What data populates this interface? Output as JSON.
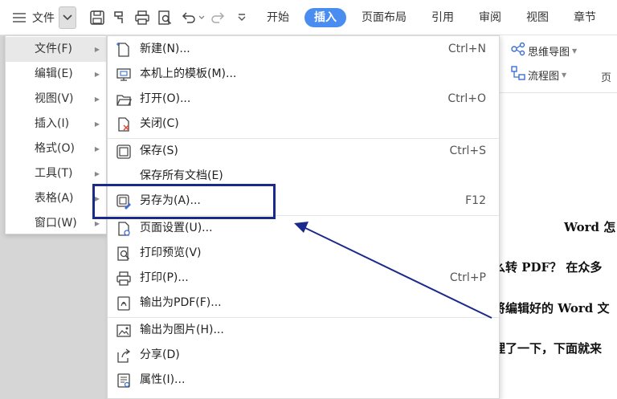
{
  "toolbar": {
    "file_label": "文件"
  },
  "tabs": [
    {
      "label": "开始"
    },
    {
      "label": "插入"
    },
    {
      "label": "页面布局"
    },
    {
      "label": "引用"
    },
    {
      "label": "审阅"
    },
    {
      "label": "视图"
    },
    {
      "label": "章节"
    }
  ],
  "active_tab": "插入",
  "ribbon": {
    "mindmap": "思维导图",
    "flowchart": "流程图",
    "partial_page": "页"
  },
  "main_menu": [
    {
      "label": "文件(F)"
    },
    {
      "label": "编辑(E)"
    },
    {
      "label": "视图(V)"
    },
    {
      "label": "插入(I)"
    },
    {
      "label": "格式(O)"
    },
    {
      "label": "工具(T)"
    },
    {
      "label": "表格(A)"
    },
    {
      "label": "窗口(W)"
    }
  ],
  "sub_menu": [
    {
      "label": "新建(N)...",
      "shortcut": "Ctrl+N",
      "icon": "new-file-icon"
    },
    {
      "label": "本机上的模板(M)...",
      "shortcut": "",
      "icon": "template-icon"
    },
    {
      "label": "打开(O)...",
      "shortcut": "Ctrl+O",
      "icon": "folder-open-icon"
    },
    {
      "label": "关闭(C)",
      "shortcut": "",
      "icon": "close-file-icon"
    },
    {
      "label": "保存(S)",
      "shortcut": "Ctrl+S",
      "icon": "save-icon"
    },
    {
      "label": "保存所有文档(E)",
      "shortcut": "",
      "icon": ""
    },
    {
      "label": "另存为(A)...",
      "shortcut": "F12",
      "icon": "save-as-icon"
    },
    {
      "label": "页面设置(U)...",
      "shortcut": "",
      "icon": "page-setup-icon"
    },
    {
      "label": "打印预览(V)",
      "shortcut": "",
      "icon": "print-preview-icon"
    },
    {
      "label": "打印(P)...",
      "shortcut": "Ctrl+P",
      "icon": "print-icon"
    },
    {
      "label": "输出为PDF(F)...",
      "shortcut": "",
      "icon": "export-pdf-icon"
    },
    {
      "label": "输出为图片(H)...",
      "shortcut": "",
      "icon": "export-image-icon"
    },
    {
      "label": "分享(D)",
      "shortcut": "",
      "icon": "share-icon"
    },
    {
      "label": "属性(I)...",
      "shortcut": "",
      "icon": "properties-icon"
    }
  ],
  "document_lines": [
    "Word 怎",
    "么转 PDF？ 在众多",
    "将编辑好的 Word 文",
    "理了一下，下面就来"
  ],
  "colors": {
    "accent": "#4a8df0",
    "highlight": "#1a2a8c"
  }
}
